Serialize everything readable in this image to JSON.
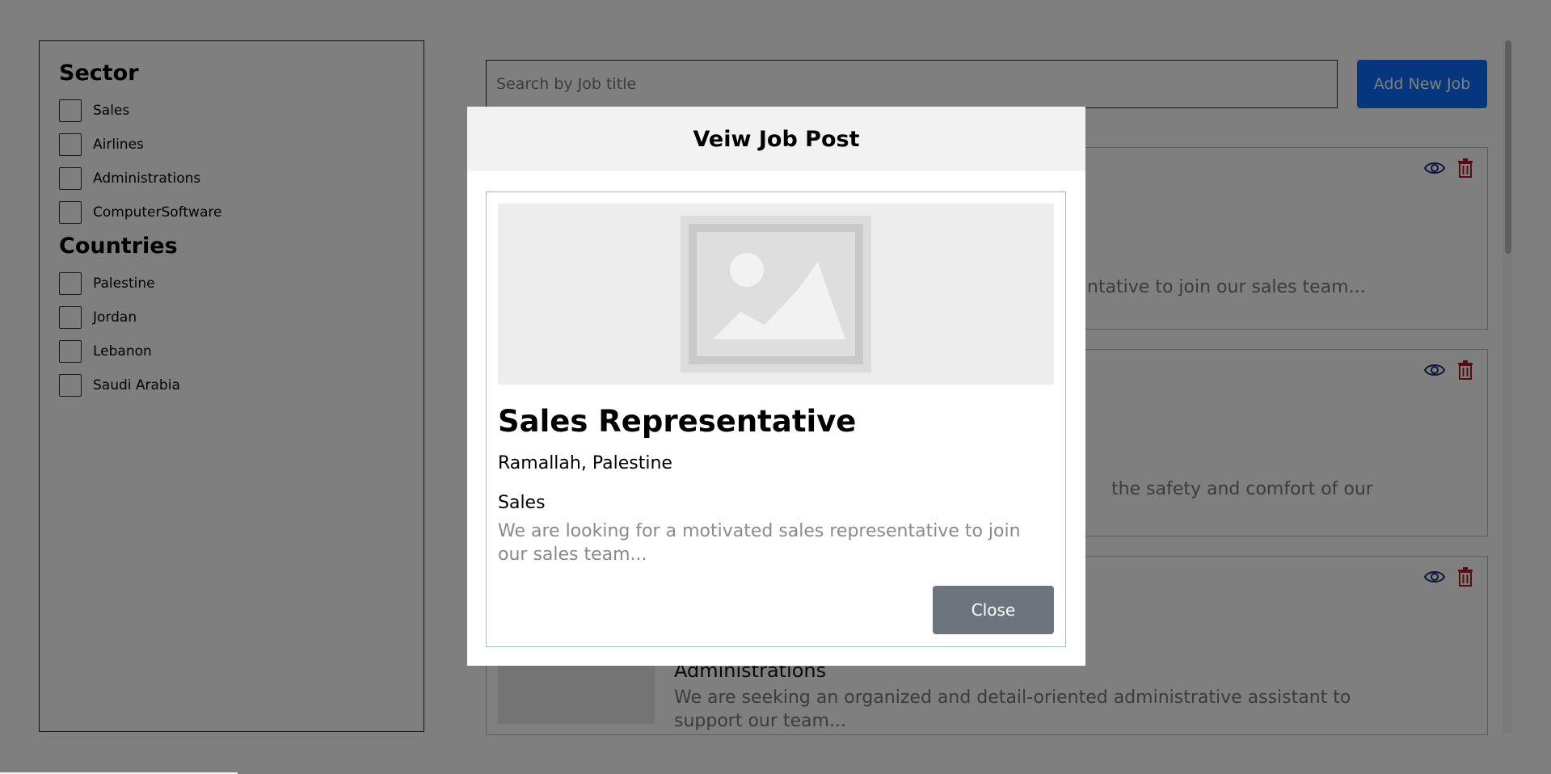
{
  "sidebar": {
    "sector_title": "Sector",
    "sectors": [
      "Sales",
      "Airlines",
      "Administrations",
      "ComputerSoftware"
    ],
    "countries_title": "Countries",
    "countries": [
      "Palestine",
      "Jordan",
      "Lebanon",
      "Saudi Arabia"
    ]
  },
  "main": {
    "search_placeholder": "Search by Job title",
    "add_button_label": "Add New Job",
    "job_cards": [
      {
        "visible_desc": "ntative to join our sales team..."
      },
      {
        "visible_desc": "the safety and comfort of our"
      },
      {
        "sector": "Administrations",
        "description": "We are seeking an organized and detail-oriented administrative assistant to support our team..."
      }
    ]
  },
  "modal": {
    "title": "Veiw Job Post",
    "job_title": "Sales Representative",
    "location": "Ramallah, Palestine",
    "sector": "Sales",
    "description": "We are looking for a motivated sales representative to join our sales team...",
    "close_label": "Close"
  },
  "colors": {
    "primary": "#0d6efd",
    "secondary": "#6c757d",
    "view_icon": "#1f2a7a",
    "delete_icon": "#b3141d",
    "overlay": "rgba(0,0,0,0.5)"
  }
}
